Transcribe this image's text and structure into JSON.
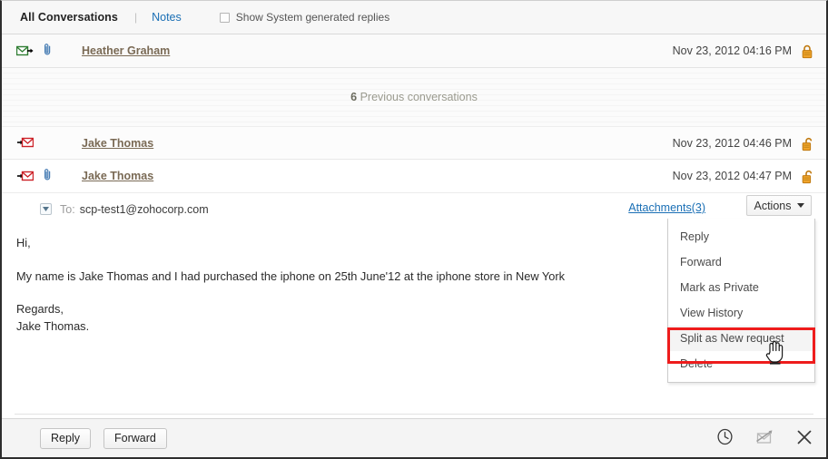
{
  "header": {
    "tab_all_conversations": "All Conversations",
    "separator": "|",
    "tab_notes": "Notes",
    "show_system_replies_label": "Show System generated replies",
    "show_system_replies_checked": false
  },
  "conversations": [
    {
      "sender": "Heather Graham",
      "date": "Nov 23, 2012 04:16 PM",
      "mail_icon": "outgoing-mail-icon",
      "mail_icon_color": "#2f7d32",
      "has_attachment": true,
      "lock_state": "locked",
      "lock_color": "#e8941a"
    },
    {
      "sender": "Jake Thomas",
      "date": "Nov 23, 2012 04:46 PM",
      "mail_icon": "incoming-mail-icon",
      "mail_icon_color": "#cc2026",
      "has_attachment": false,
      "lock_state": "unlocked",
      "lock_color": "#e8941a"
    },
    {
      "sender": "Jake Thomas",
      "date": "Nov 23, 2012 04:47 PM",
      "mail_icon": "incoming-mail-icon",
      "mail_icon_color": "#cc2026",
      "has_attachment": true,
      "lock_state": "unlocked",
      "lock_color": "#e8941a"
    }
  ],
  "previous_band": {
    "count": "6",
    "text": " Previous conversations"
  },
  "message": {
    "to_label": "To:",
    "to_value": "scp-test1@zohocorp.com",
    "attachments_link": "Attachments(3)",
    "actions_button": "Actions",
    "body_line_1": "Hi,",
    "body_line_2": "My name is Jake Thomas and I had purchased the iphone on 25th June'12 at the iphone store in New York",
    "body_line_3": "Regards,",
    "body_line_4": "Jake Thomas."
  },
  "actions_menu": {
    "items": [
      {
        "label": "Reply",
        "highlighted": false
      },
      {
        "label": "Forward",
        "highlighted": false
      },
      {
        "label": "Mark as Private",
        "highlighted": false
      },
      {
        "label": "View History",
        "highlighted": false
      },
      {
        "label": "Split as New request",
        "highlighted": true
      },
      {
        "label": "Delete",
        "highlighted": false
      }
    ],
    "highlight_color": "#ee1c1c"
  },
  "footer": {
    "reply_button": "Reply",
    "forward_button": "Forward",
    "icons": [
      "clock-icon",
      "mail-reply-icon",
      "close-icon"
    ]
  }
}
